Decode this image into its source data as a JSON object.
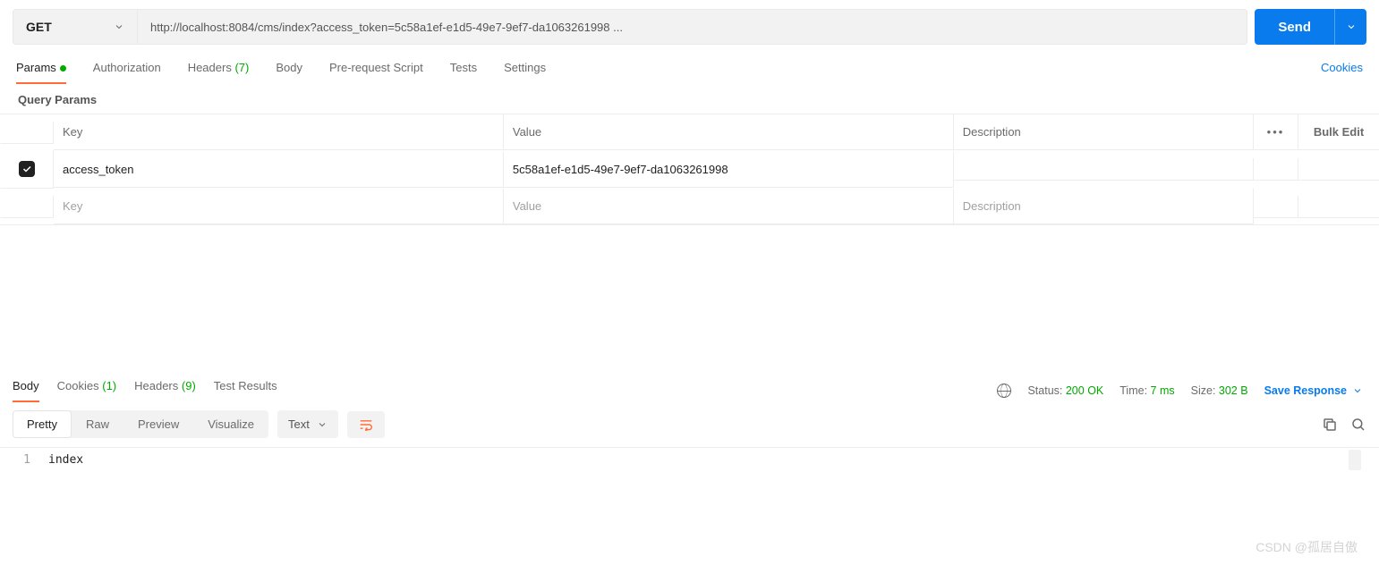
{
  "request": {
    "method": "GET",
    "url": "http://localhost:8084/cms/index?access_token=5c58a1ef-e1d5-49e7-9ef7-da1063261998 ...",
    "send_label": "Send"
  },
  "tabs": {
    "params": "Params",
    "authorization": "Authorization",
    "headers_label": "Headers",
    "headers_count": "(7)",
    "body": "Body",
    "prerequest": "Pre-request Script",
    "tests": "Tests",
    "settings": "Settings",
    "cookies_link": "Cookies"
  },
  "query": {
    "section_title": "Query Params",
    "head_key": "Key",
    "head_value": "Value",
    "head_desc": "Description",
    "bulk_edit": "Bulk Edit",
    "rows": [
      {
        "key": "access_token",
        "value": "5c58a1ef-e1d5-49e7-9ef7-da1063261998",
        "desc": ""
      }
    ],
    "ph_key": "Key",
    "ph_value": "Value",
    "ph_desc": "Description"
  },
  "response": {
    "tabs": {
      "body": "Body",
      "cookies_label": "Cookies",
      "cookies_count": "(1)",
      "headers_label": "Headers",
      "headers_count": "(9)",
      "tests": "Test Results"
    },
    "status_label": "Status:",
    "status_value": "200 OK",
    "time_label": "Time:",
    "time_value": "7 ms",
    "size_label": "Size:",
    "size_value": "302 B",
    "save_label": "Save Response",
    "view": {
      "pretty": "Pretty",
      "raw": "Raw",
      "preview": "Preview",
      "visualize": "Visualize"
    },
    "format": "Text",
    "body_line_no": "1",
    "body_text": "index"
  },
  "watermark": "CSDN @孤居自傲"
}
